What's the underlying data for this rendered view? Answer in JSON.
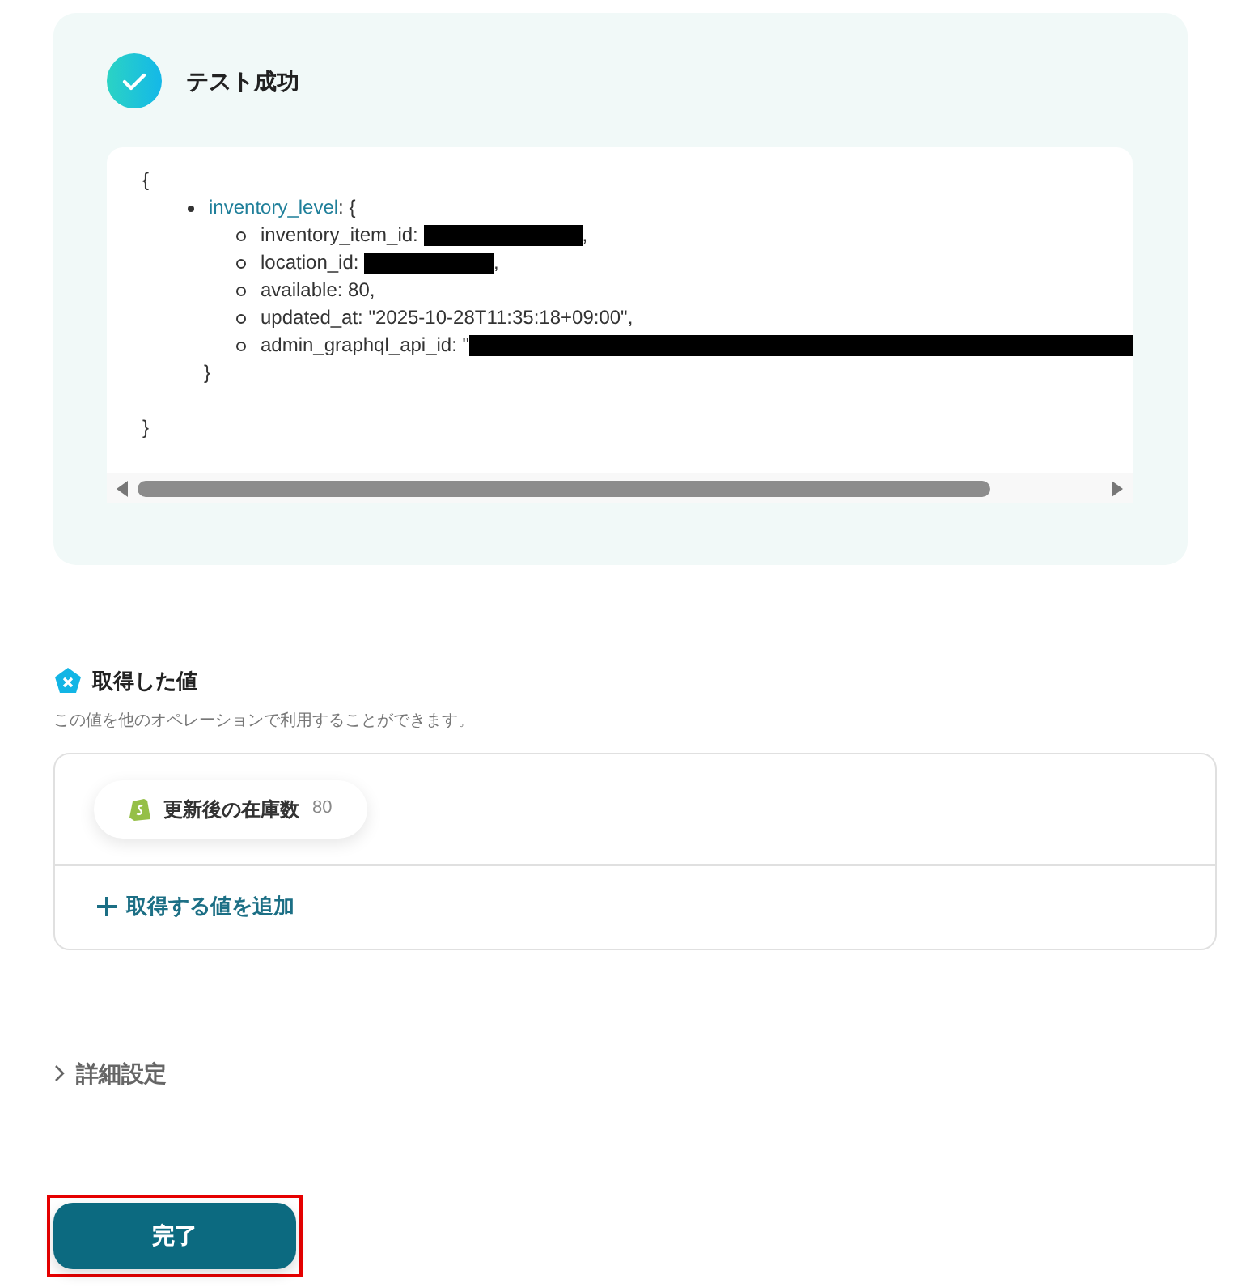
{
  "test_result": {
    "title": "テスト成功",
    "success": true,
    "code": {
      "open": "{",
      "key": "inventory_level",
      "key_open": ": {",
      "fields": [
        {
          "label": "inventory_item_id: ",
          "redacted": true,
          "suffix": ","
        },
        {
          "label": "location_id: ",
          "redacted": true,
          "suffix": ","
        },
        {
          "label": "available: 80,",
          "redacted": false
        },
        {
          "label": "updated_at: \"2025-10-28T11:35:18+09:00\",",
          "redacted": false
        },
        {
          "label": "admin_graphql_api_id: \"",
          "redacted": true
        }
      ],
      "inner_close": "}",
      "close": "}"
    }
  },
  "values_section": {
    "title": "取得した値",
    "description": "この値を他のオペレーションで利用することができます。",
    "items": [
      {
        "label": "更新後の在庫数",
        "value": "80"
      }
    ],
    "add_label": "取得する値を追加"
  },
  "advanced": {
    "label": "詳細設定",
    "expanded": false
  },
  "done_button": {
    "label": "完了",
    "highlighted": true
  }
}
